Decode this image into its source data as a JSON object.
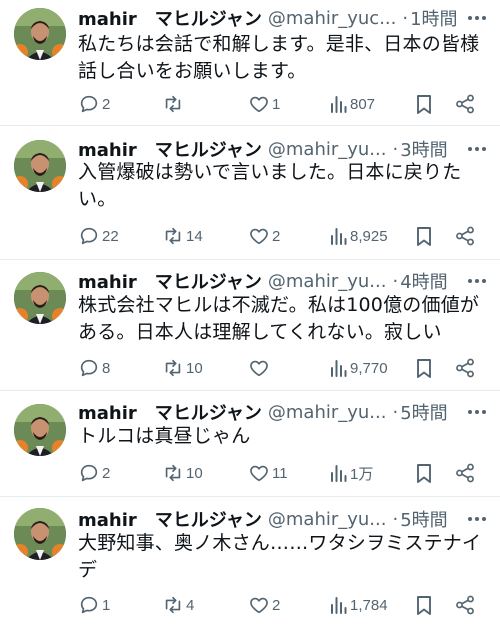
{
  "tweets": [
    {
      "name": "mahir　マヒルジャン",
      "handle": "@mahir_yuc...",
      "dot": "·",
      "time": "1時間",
      "lines": [
        "私たちは会話で和解します。是非、日本の皆様",
        "話し合いをお願いします。"
      ],
      "replies": "2",
      "retweets": "",
      "likes": "1",
      "views": "807"
    },
    {
      "name": "mahir　マヒルジャン",
      "handle": "@mahir_yu...",
      "dot": "·",
      "time": "3時間",
      "lines": [
        "入管爆破は勢いで言いました。日本に戻りた",
        "い。"
      ],
      "replies": "22",
      "retweets": "14",
      "likes": "2",
      "views": "8,925"
    },
    {
      "name": "mahir　マヒルジャン",
      "handle": "@mahir_yu...",
      "dot": "·",
      "time": "4時間",
      "lines": [
        "株式会社マヒルは不滅だ。私は100億の価値が",
        "ある。日本人は理解してくれない。寂しい"
      ],
      "replies": "8",
      "retweets": "10",
      "likes": "",
      "views": "9,770"
    },
    {
      "name": "mahir　マヒルジャン",
      "handle": "@mahir_yu...",
      "dot": "·",
      "time": "5時間",
      "lines": [
        "トルコは真昼じゃん"
      ],
      "replies": "2",
      "retweets": "10",
      "likes": "11",
      "views": "1万"
    },
    {
      "name": "mahir　マヒルジャン",
      "handle": "@mahir_yu...",
      "dot": "·",
      "time": "5時間",
      "lines": [
        "大野知事、奥ノ木さん……ワタシヲミステナイ",
        "デ"
      ],
      "replies": "1",
      "retweets": "4",
      "likes": "2",
      "views": "1,784"
    }
  ],
  "icons": {
    "reply": "reply-icon",
    "retweet": "retweet-icon",
    "like": "heart-icon",
    "views": "views-icon",
    "bookmark": "bookmark-icon",
    "share": "share-icon",
    "more": "more-icon"
  },
  "colors": {
    "icon_gray": "#536471",
    "text": "#0f1419",
    "divider": "#e6ecf0"
  }
}
